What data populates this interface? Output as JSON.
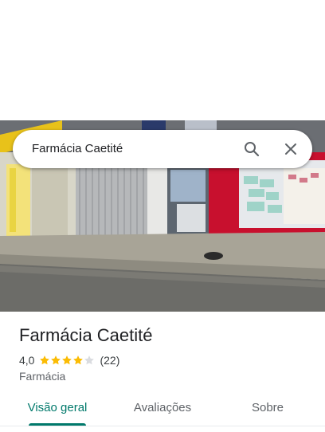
{
  "search": {
    "query": "Farmácia Caetité"
  },
  "place": {
    "name": "Farmácia Caetité",
    "rating": "4,0",
    "rating_fraction": 0.8,
    "reviews": "(22)",
    "category": "Farmácia"
  },
  "tabs": [
    {
      "label": "Visão geral",
      "active": true
    },
    {
      "label": "Avaliações",
      "active": false
    },
    {
      "label": "Sobre",
      "active": false
    }
  ],
  "colors": {
    "accent": "#00796b",
    "star": "#fbbc04",
    "star_empty": "#dadce0"
  },
  "icons": {
    "search": "search-icon",
    "close": "close-icon",
    "star": "star-icon"
  }
}
